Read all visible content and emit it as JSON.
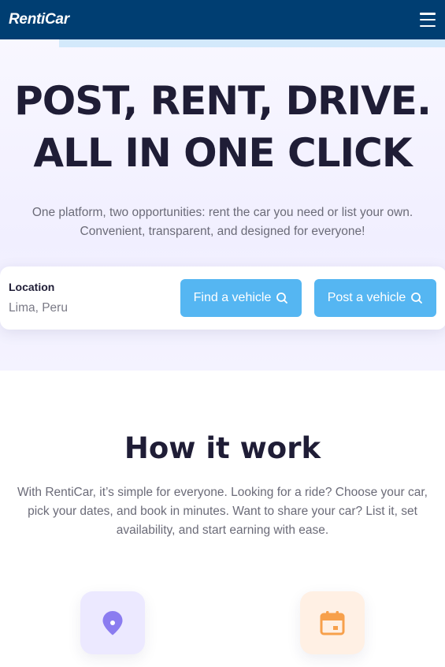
{
  "navbar": {
    "brand": "RentiCar",
    "menu_icon": "hamburger-menu-icon"
  },
  "hero": {
    "title_line1": "POST, RENT, DRIVE.",
    "title_line2": "ALL IN ONE CLICK",
    "subtitle_line1": "One platform, two opportunities: rent the car you need or list your own.",
    "subtitle_line2": "Convenient, transparent, and designed for everyone!"
  },
  "search": {
    "location_label": "Location",
    "location_value": "Lima, Peru",
    "find_button": "Find a vehicle",
    "post_button": "Post a vehicle",
    "button_icon": "search-icon"
  },
  "how_it_works": {
    "title": "How it work",
    "description_line1": "With RentiCar, it’s simple for everyone. Looking for a ride? Choose your car,",
    "description_line2": "pick your dates, and book in minutes. Want to share your car? List it, set",
    "description_line3": "availability, and start earning with ease.",
    "features": [
      {
        "icon": "location-pin-icon",
        "color": "#8b7cf0"
      },
      {
        "icon": "calendar-icon",
        "color": "#f7a04b"
      }
    ]
  },
  "colors": {
    "navbar": "#003e72",
    "accent_button": "#55b6f2",
    "heading": "#1f1d36",
    "body_text": "#6b6b78"
  }
}
